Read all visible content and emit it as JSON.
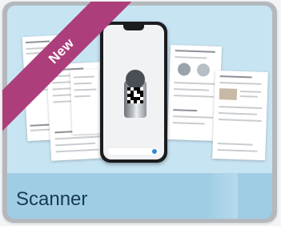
{
  "tile": {
    "badge": "New",
    "title": "Scanner"
  },
  "colors": {
    "badge": "#ad3e7c",
    "image_bg": "#c7e4f3",
    "title_bar": "#9fcde4",
    "title_text": "#163b52"
  },
  "icons": [
    "smartphone-icon",
    "barcode-scanner-device-icon",
    "qr-code-icon",
    "send-icon"
  ]
}
